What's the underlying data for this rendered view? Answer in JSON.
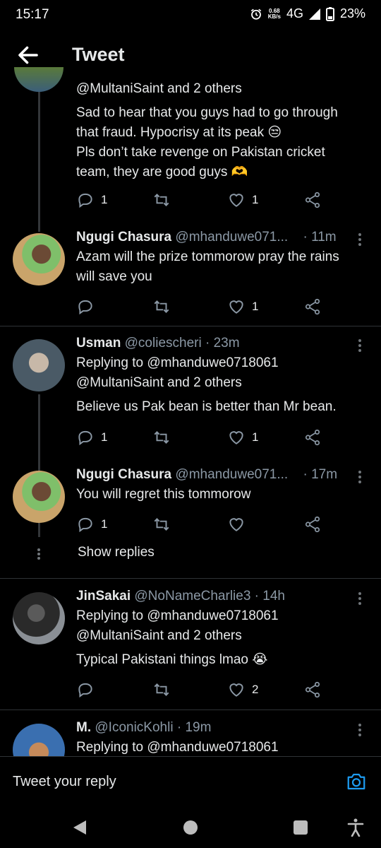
{
  "status": {
    "time": "15:17",
    "net_speed": "0.68",
    "net_unit": "KB/s",
    "network": "4G",
    "battery": "23%"
  },
  "header": {
    "title": "Tweet"
  },
  "tweets": [
    {
      "replying_line2": "@MultaniSaint and 2 others",
      "body": [
        "Sad to hear that you guys had to go through",
        "that fraud. Hypocrisy at its peak 😒",
        "Pls don’t take revenge on Pakistan cricket",
        "team, they are good guys 🫶"
      ],
      "replies": "1",
      "retweets": "",
      "likes": "1"
    },
    {
      "name": "Ngugi Chasura",
      "handle": "@mhanduwe071...",
      "time": "· 11m",
      "body": [
        "Azam will the prize tommorow pray the rains",
        "will save you"
      ],
      "replies": "",
      "retweets": "",
      "likes": "1"
    },
    {
      "name": "Usman",
      "handle": "@coliescheri · 23m",
      "replying_line1": "Replying to @mhanduwe0718061",
      "replying_line2": "@MultaniSaint and 2 others",
      "body": [
        "Believe us Pak bean is better than Mr bean."
      ],
      "replies": "1",
      "retweets": "",
      "likes": "1"
    },
    {
      "name": "Ngugi Chasura",
      "handle": "@mhanduwe071...",
      "time": "· 17m",
      "body": [
        "You will regret this tommorow"
      ],
      "replies": "1",
      "retweets": "",
      "likes": "",
      "show_replies": "Show replies"
    },
    {
      "name": "JinSakai",
      "handle": "@NoNameCharlie3 · 14h",
      "replying_line1": "Replying to @mhanduwe0718061",
      "replying_line2": "@MultaniSaint and 2 others",
      "body": [
        "Typical Pakistani things lmao 😭"
      ],
      "replies": "",
      "retweets": "",
      "likes": "2"
    },
    {
      "name": "M.",
      "handle": "@IconicKohli · 19m",
      "replying_line1": "Replying to @mhanduwe0718061"
    }
  ],
  "reply_bar": {
    "placeholder": "Tweet your reply"
  },
  "colors": {
    "background": "#000000",
    "text": "#e7e9ea",
    "muted": "#8b98a5",
    "accent": "#1d9bf0",
    "divider": "#2f3336"
  }
}
